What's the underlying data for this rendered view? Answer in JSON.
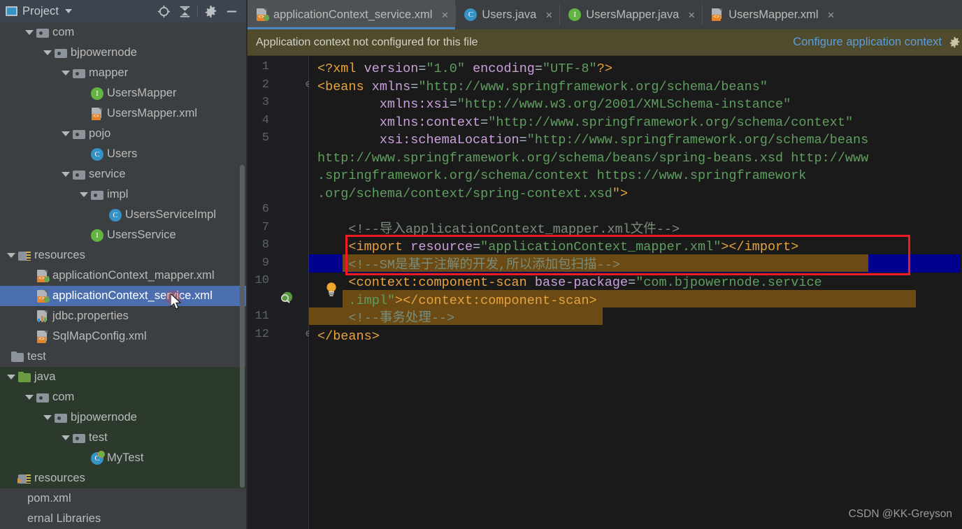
{
  "window": {
    "watermark": "CSDN @KK-Greyson"
  },
  "sidebar": {
    "title": "Project",
    "icons": {
      "project": "project-icon",
      "dropdown": "chevron-down-icon",
      "locate": "crosshair-locate-icon",
      "collapse": "collapse-all-icon",
      "settings": "gear-icon",
      "minimize": "minimize-icon"
    },
    "tree": [
      {
        "label": "com",
        "indent": 1,
        "icon": "package",
        "arrow": "open",
        "state": "normal"
      },
      {
        "label": "bjpowernode",
        "indent": 2,
        "icon": "package",
        "arrow": "open",
        "state": "normal"
      },
      {
        "label": "mapper",
        "indent": 3,
        "icon": "package",
        "arrow": "open",
        "state": "normal"
      },
      {
        "label": "UsersMapper",
        "indent": 4,
        "icon": "interface",
        "arrow": "none",
        "state": "normal"
      },
      {
        "label": "UsersMapper.xml",
        "indent": 4,
        "icon": "xml",
        "arrow": "none",
        "state": "normal"
      },
      {
        "label": "pojo",
        "indent": 3,
        "icon": "package",
        "arrow": "open",
        "state": "normal"
      },
      {
        "label": "Users",
        "indent": 4,
        "icon": "class",
        "arrow": "none",
        "state": "normal"
      },
      {
        "label": "service",
        "indent": 3,
        "icon": "package",
        "arrow": "open",
        "state": "normal"
      },
      {
        "label": "impl",
        "indent": 4,
        "icon": "package",
        "arrow": "open",
        "state": "normal"
      },
      {
        "label": "UsersServiceImpl",
        "indent": 5,
        "icon": "class",
        "arrow": "none",
        "state": "normal"
      },
      {
        "label": "UsersService",
        "indent": 4,
        "icon": "interface",
        "arrow": "none",
        "state": "normal"
      },
      {
        "label": "resources",
        "indent": 0,
        "icon": "resources",
        "arrow": "open",
        "state": "normal"
      },
      {
        "label": "applicationContext_mapper.xml",
        "indent": 1,
        "icon": "springxml",
        "arrow": "none",
        "state": "normal"
      },
      {
        "label": "applicationContext_service.xml",
        "indent": 1,
        "icon": "springxml",
        "arrow": "none",
        "state": "selected"
      },
      {
        "label": "jdbc.properties",
        "indent": 1,
        "icon": "properties",
        "arrow": "none",
        "state": "normal"
      },
      {
        "label": "SqlMapConfig.xml",
        "indent": 1,
        "icon": "xml",
        "arrow": "none",
        "state": "normal"
      },
      {
        "label": "test",
        "indent": -1,
        "icon": "folder",
        "arrow": "none",
        "state": "normal"
      },
      {
        "label": "java",
        "indent": 0,
        "icon": "srcfolder",
        "arrow": "open",
        "state": "green"
      },
      {
        "label": "com",
        "indent": 1,
        "icon": "package",
        "arrow": "open",
        "state": "green"
      },
      {
        "label": "bjpowernode",
        "indent": 2,
        "icon": "package",
        "arrow": "open",
        "state": "green"
      },
      {
        "label": "test",
        "indent": 3,
        "icon": "package",
        "arrow": "open",
        "state": "green"
      },
      {
        "label": "MyTest",
        "indent": 4,
        "icon": "testclass",
        "arrow": "none",
        "state": "green"
      },
      {
        "label": "resources",
        "indent": 0,
        "icon": "testres",
        "arrow": "none",
        "state": "green"
      },
      {
        "label": "pom.xml",
        "indent": -1,
        "icon": "none",
        "arrow": "none",
        "state": "normal"
      },
      {
        "label": "ernal Libraries",
        "indent": -1,
        "icon": "none",
        "arrow": "none",
        "state": "normal"
      }
    ]
  },
  "editor": {
    "tabs": [
      {
        "label": "applicationContext_service.xml",
        "icon": "springxml-icon",
        "active": true,
        "close": "×"
      },
      {
        "label": "Users.java",
        "icon": "class-icon",
        "active": false,
        "close": "×"
      },
      {
        "label": "UsersMapper.java",
        "icon": "interface-icon",
        "active": false,
        "close": "×"
      },
      {
        "label": "UsersMapper.xml",
        "icon": "xml-icon",
        "active": false,
        "close": "×"
      }
    ],
    "notification": {
      "message": "Application context not configured for this file",
      "action_link": "Configure application context",
      "settings_icon": "gear-icon"
    },
    "gutter": {
      "line_numbers": [
        "1",
        "2",
        "3",
        "4",
        "5",
        "6",
        "7",
        "8",
        "9",
        "10",
        "11",
        "12"
      ],
      "intention_bulb": "lightbulb-icon",
      "inspection_badge": "spring-bean-icon"
    },
    "code_lines": [
      {
        "n": 1,
        "segments": [
          {
            "t": "<?xml ",
            "c": "tg"
          },
          {
            "t": "version",
            "c": "at"
          },
          {
            "t": "=",
            "c": "pl"
          },
          {
            "t": "\"1.0\"",
            "c": "st"
          },
          {
            "t": " ",
            "c": "pl"
          },
          {
            "t": "encoding",
            "c": "at"
          },
          {
            "t": "=",
            "c": "pl"
          },
          {
            "t": "\"UTF-8\"",
            "c": "st"
          },
          {
            "t": "?>",
            "c": "tg"
          }
        ]
      },
      {
        "n": 2,
        "segments": [
          {
            "t": "<beans ",
            "c": "tg"
          },
          {
            "t": "xmlns",
            "c": "at"
          },
          {
            "t": "=",
            "c": "pl"
          },
          {
            "t": "\"http://www.springframework.org/schema/beans\"",
            "c": "st"
          }
        ]
      },
      {
        "n": 3,
        "segments": [
          {
            "t": "        ",
            "c": "pl"
          },
          {
            "t": "xmlns:xsi",
            "c": "at"
          },
          {
            "t": "=",
            "c": "pl"
          },
          {
            "t": "\"http://www.w3.org/2001/XMLSchema-instance\"",
            "c": "st"
          }
        ]
      },
      {
        "n": 4,
        "segments": [
          {
            "t": "        ",
            "c": "pl"
          },
          {
            "t": "xmlns:context",
            "c": "at"
          },
          {
            "t": "=",
            "c": "pl"
          },
          {
            "t": "\"http://www.springframework.org/schema/context\"",
            "c": "st"
          }
        ]
      },
      {
        "n": 5,
        "segments": [
          {
            "t": "        ",
            "c": "pl"
          },
          {
            "t": "xsi:schemaLocation",
            "c": "at"
          },
          {
            "t": "=",
            "c": "pl"
          },
          {
            "t": "\"http://www.springframework.org/schema/beans",
            "c": "st"
          }
        ]
      },
      {
        "n": null,
        "segments": [
          {
            "t": "http://www.springframework.org/schema/beans/spring-beans.xsd http://www",
            "c": "st"
          }
        ]
      },
      {
        "n": null,
        "segments": [
          {
            "t": ".springframework.org/schema/context https://www.springframework",
            "c": "st"
          }
        ]
      },
      {
        "n": null,
        "segments": [
          {
            "t": ".org/schema/context/spring-context.xsd",
            "c": "st"
          },
          {
            "t": "\">",
            "c": "tg"
          }
        ]
      },
      {
        "n": 6,
        "segments": []
      },
      {
        "n": 7,
        "segments": [
          {
            "t": "    <!--导入applicationContext_mapper.xml文件-->",
            "c": "cm"
          }
        ]
      },
      {
        "n": 8,
        "segments": [
          {
            "t": "    <import ",
            "c": "tg"
          },
          {
            "t": "resource",
            "c": "at"
          },
          {
            "t": "=",
            "c": "pl"
          },
          {
            "t": "\"applicationContext_mapper.xml\"",
            "c": "st"
          },
          {
            "t": "></import>",
            "c": "tg"
          }
        ]
      },
      {
        "n": 9,
        "segments": [
          {
            "t": "    <!--SM是基于注解的开发,所以添加包扫描-->",
            "c": "cm"
          }
        ]
      },
      {
        "n": 10,
        "segments": [
          {
            "t": "    <context:component-scan ",
            "c": "tg"
          },
          {
            "t": "base-package",
            "c": "at"
          },
          {
            "t": "=",
            "c": "pl"
          },
          {
            "t": "\"com.bjpowernode.service",
            "c": "st"
          }
        ]
      },
      {
        "n": null,
        "segments": [
          {
            "t": "    .impl\"",
            "c": "st"
          },
          {
            "t": "></context:component-scan>",
            "c": "tg"
          }
        ]
      },
      {
        "n": 11,
        "segments": [
          {
            "t": "    <!--事务处理-->",
            "c": "cm"
          }
        ]
      },
      {
        "n": 12,
        "segments": [
          {
            "t": "</beans>",
            "c": "tg"
          }
        ]
      }
    ],
    "annotation": {
      "type": "red-rectangle",
      "target": "import statement lines 7-8"
    }
  },
  "colors": {
    "accent_blue": "#4b6eaf",
    "tab_underline": "#4a88c7",
    "notification_bg": "#4f4b2c",
    "annotation_red": "#ee1b24",
    "selection_navy": "#00008f",
    "highlight_brown": "#6b4a14",
    "editor_bg": "#1a1a1a",
    "panel_bg": "#3c3f41"
  }
}
